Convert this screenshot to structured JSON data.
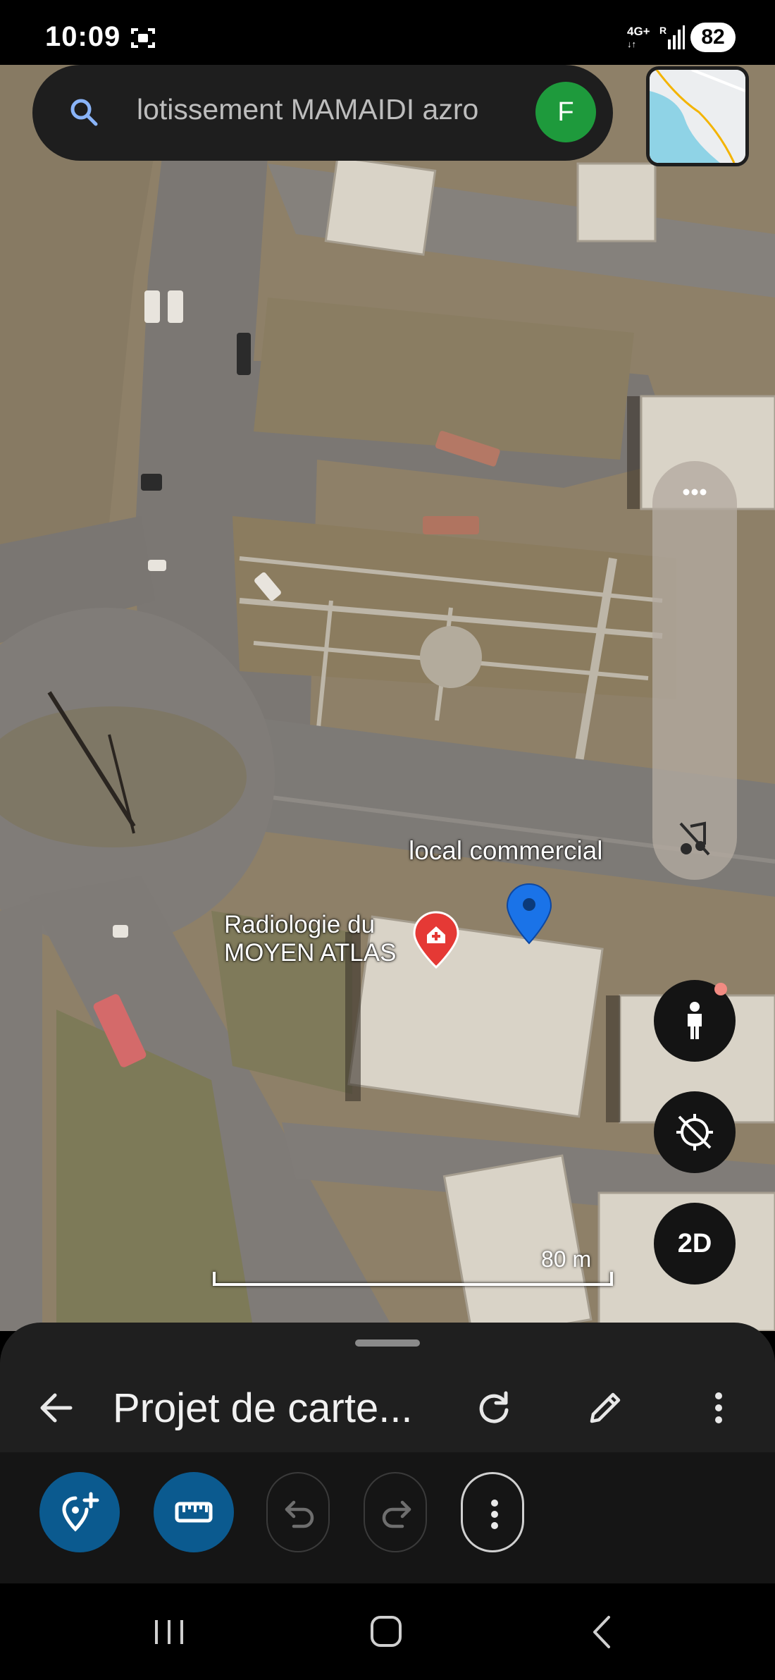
{
  "status_bar": {
    "time": "10:09",
    "network": "4G+",
    "network_sub": "R",
    "battery": "82"
  },
  "search": {
    "query": "lotissement MAMAIDI azro",
    "avatar_letter": "F"
  },
  "map": {
    "labels": {
      "place_pin": "local commercial",
      "poi_line1": "Radiologie du",
      "poi_line2": "MOYEN ATLAS"
    },
    "scale": "80 m",
    "view_mode_button": "2D"
  },
  "sheet": {
    "title": "Projet de carte..."
  },
  "colors": {
    "accent_blue": "#1a73e8",
    "tool_button_blue": "#0b5a8f",
    "avatar_green": "#1e9a3c",
    "poi_red": "#e53935"
  },
  "icons": {
    "search": "search-icon",
    "pegman": "street-view-icon",
    "compass": "compass-off-icon",
    "add_pin": "add-place-icon",
    "measure": "ruler-icon",
    "undo": "undo-icon",
    "redo": "redo-icon"
  }
}
